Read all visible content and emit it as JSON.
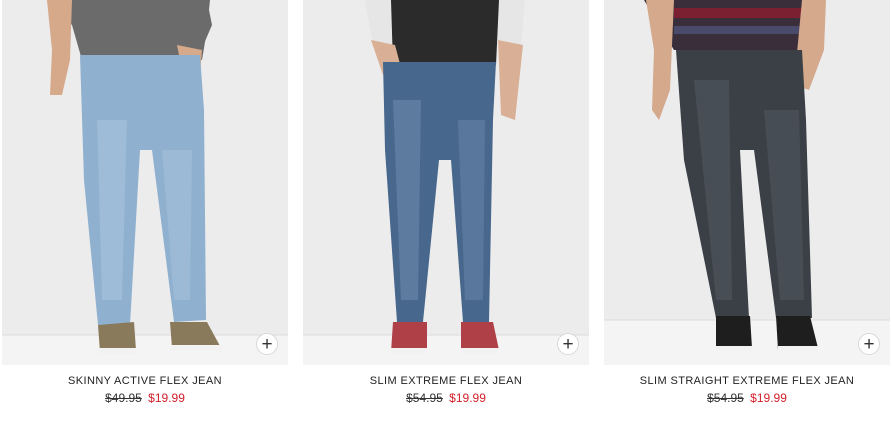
{
  "products": [
    {
      "title": "SKINNY ACTIVE FLEX JEAN",
      "original_price": "$49.95",
      "sale_price": "$19.99",
      "wash": "#8fb0cf",
      "shirt": "#6b6b6b",
      "shoe": "#8a7a5c",
      "quick_add_icon": "plus-icon"
    },
    {
      "title": "SLIM EXTREME FLEX JEAN",
      "original_price": "$54.95",
      "sale_price": "$19.99",
      "wash": "#48678d",
      "shirt": "#2b2b2b",
      "shoe": "#b04048",
      "quick_add_icon": "plus-icon"
    },
    {
      "title": "SLIM STRAIGHT EXTREME FLEX JEAN",
      "original_price": "$54.95",
      "sale_price": "$19.99",
      "wash": "#3b4046",
      "shirt": "#3a2e3a",
      "shoe": "#1e1e1e",
      "quick_add_icon": "plus-icon"
    }
  ],
  "colors": {
    "sale": "#d3202a",
    "backdrop": "#ececec",
    "floor": "#f4f4f4"
  }
}
